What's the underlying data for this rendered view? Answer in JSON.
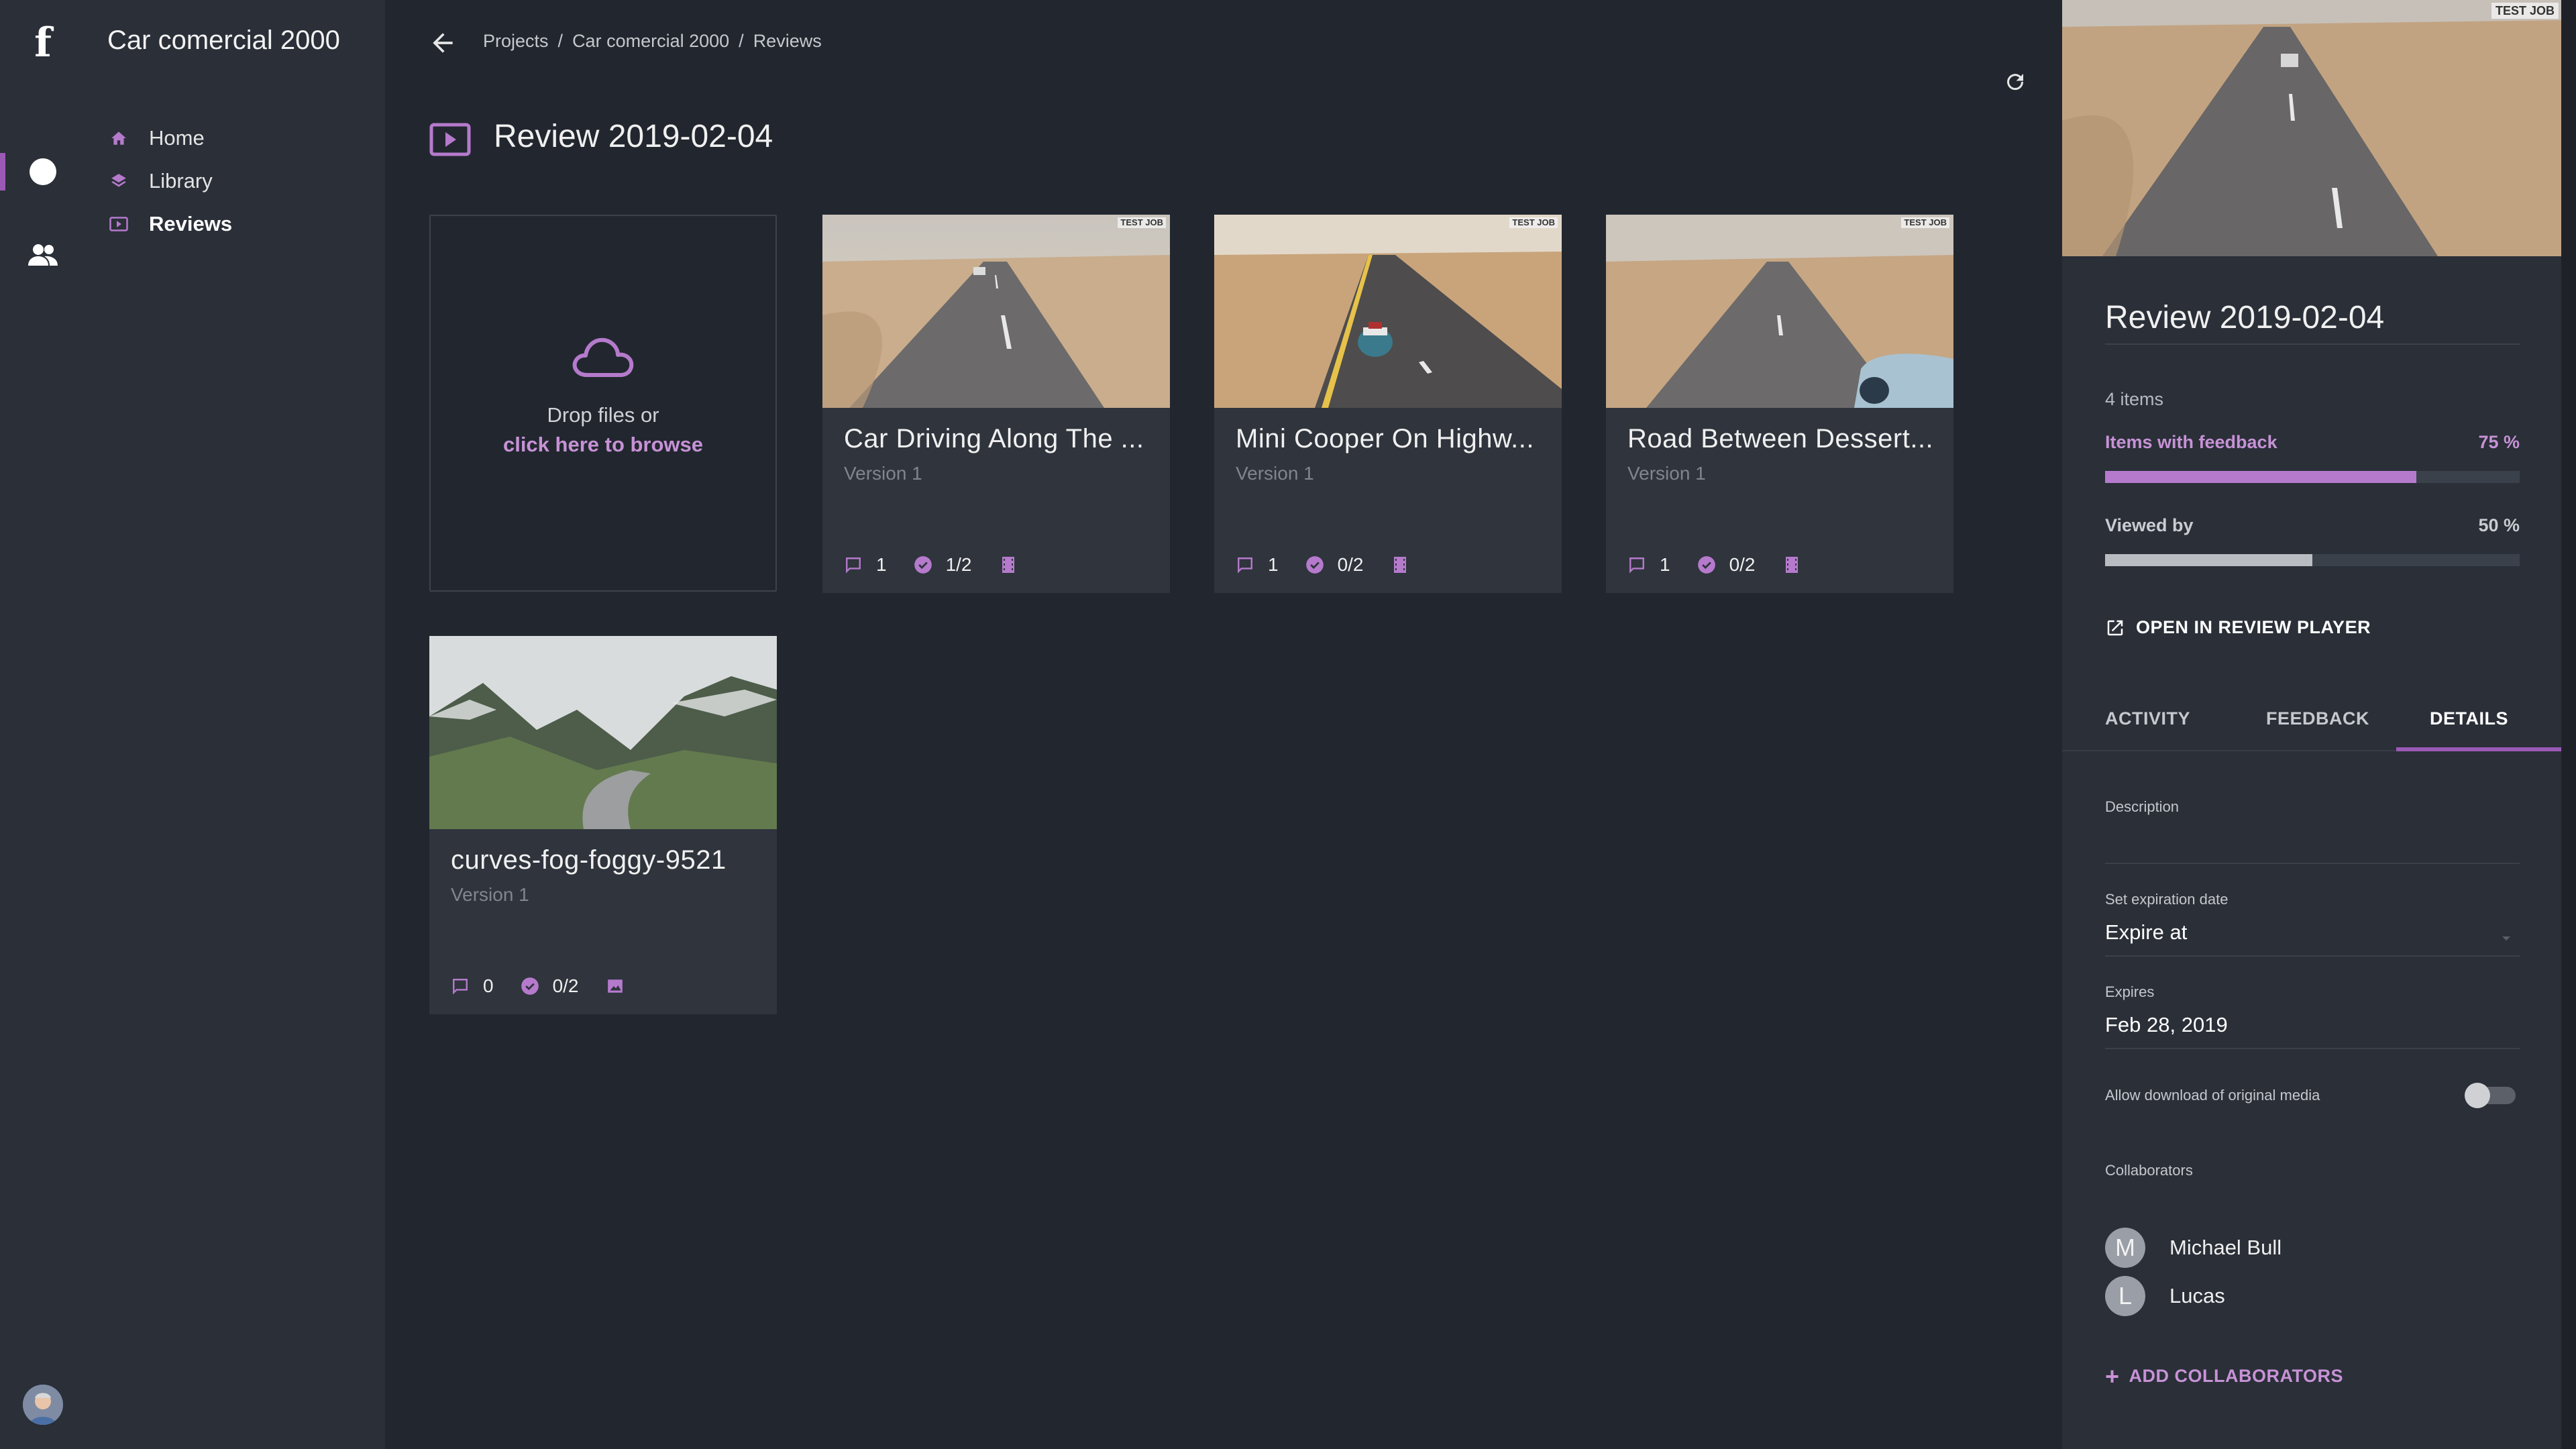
{
  "app": {
    "logo": "f"
  },
  "sidebar": {
    "project_title": "Car comercial 2000",
    "items": [
      {
        "label": "Home",
        "icon": "home-icon"
      },
      {
        "label": "Library",
        "icon": "layers-icon"
      },
      {
        "label": "Reviews",
        "icon": "review-icon",
        "active": true
      }
    ]
  },
  "header": {
    "breadcrumb": [
      "Projects",
      "Car comercial 2000",
      "Reviews"
    ],
    "title": "Review 2019-02-04"
  },
  "dropzone": {
    "line1": "Drop files or",
    "link": "click here to browse"
  },
  "cards": [
    {
      "name": "Car Driving Along The ...",
      "version": "Version 1",
      "comments": "1",
      "approvals": "1/2",
      "type_icon": "film-icon",
      "watermark": "TEST JOB"
    },
    {
      "name": "Mini Cooper On Highw...",
      "version": "Version 1",
      "comments": "1",
      "approvals": "0/2",
      "type_icon": "film-icon",
      "watermark": "TEST JOB"
    },
    {
      "name": "Road Between Dessert...",
      "version": "Version 1",
      "comments": "1",
      "approvals": "0/2",
      "type_icon": "film-icon",
      "watermark": "TEST JOB"
    },
    {
      "name": "curves-fog-foggy-9521",
      "version": "Version 1",
      "comments": "0",
      "approvals": "0/2",
      "type_icon": "image-icon"
    }
  ],
  "panel": {
    "watermark": "TEST JOB",
    "title": "Review 2019-02-04",
    "count": "4 items",
    "feedback_label": "Items with feedback",
    "feedback_pct": "75 %",
    "feedback_value": 0.75,
    "viewed_label": "Viewed by",
    "viewed_pct": "50 %",
    "viewed_value": 0.5,
    "open_player": "OPEN IN REVIEW PLAYER",
    "tabs": [
      "ACTIVITY",
      "FEEDBACK",
      "DETAILS"
    ],
    "active_tab": "DETAILS",
    "description_label": "Description",
    "expiration_label": "Set expiration date",
    "expiration_value": "Expire at",
    "expires_label": "Expires",
    "expires_value": "Feb 28, 2019",
    "download_label": "Allow download of original media",
    "download_enabled": false,
    "collaborators_label": "Collaborators",
    "collaborators": [
      {
        "initial": "M",
        "name": "Michael Bull"
      },
      {
        "initial": "L",
        "name": "Lucas"
      }
    ],
    "add_collaborators": "ADD COLLABORATORS"
  },
  "colors": {
    "accent": "#9b59b6",
    "accent_light": "#c792d6",
    "background": "#22272f",
    "sidebar": "#2a2f38",
    "card": "#2f343d"
  }
}
